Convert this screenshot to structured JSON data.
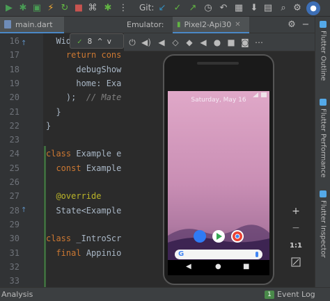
{
  "toolbar": {
    "git_label": "Git:",
    "icons": [
      "run-icon",
      "debug-icon",
      "coverage-icon",
      "lightning-icon",
      "stop-icon",
      "devtools-icon",
      "attach-icon",
      "git-update-icon",
      "git-commit-icon",
      "git-push-icon",
      "history-icon",
      "revert-icon",
      "search-icon",
      "settings-icon",
      "avatar-icon"
    ]
  },
  "editor": {
    "tab_label": "main.dart",
    "hint": {
      "check_count": "8",
      "arrows": "^ v"
    },
    "line_numbers": [
      "16",
      "17",
      "18",
      "19",
      "20",
      "21",
      "22",
      "23",
      "24",
      "25",
      "26",
      "27",
      "28",
      "29",
      "30",
      "31",
      "32",
      "33"
    ],
    "code_lines": [
      {
        "indent": "  ",
        "parts": [
          {
            "t": "Wid",
            "c": ""
          }
        ]
      },
      {
        "indent": "    ",
        "parts": [
          {
            "t": "return ",
            "c": "kw"
          },
          {
            "t": "cons",
            "c": "kw"
          }
        ]
      },
      {
        "indent": "      ",
        "parts": [
          {
            "t": "debugShow",
            "c": ""
          }
        ]
      },
      {
        "indent": "      ",
        "parts": [
          {
            "t": "home: Exa",
            "c": ""
          }
        ]
      },
      {
        "indent": "    ",
        "parts": [
          {
            "t": ");  ",
            "c": ""
          },
          {
            "t": "// Mate",
            "c": "cm"
          }
        ]
      },
      {
        "indent": "  ",
        "parts": [
          {
            "t": "}",
            "c": ""
          }
        ]
      },
      {
        "indent": "",
        "parts": [
          {
            "t": "}",
            "c": ""
          }
        ]
      },
      {
        "indent": "",
        "parts": [
          {
            "t": "",
            "c": ""
          }
        ]
      },
      {
        "indent": "",
        "parts": [
          {
            "t": "class ",
            "c": "kw"
          },
          {
            "t": "Example e",
            "c": ""
          }
        ]
      },
      {
        "indent": "  ",
        "parts": [
          {
            "t": "const ",
            "c": "kw"
          },
          {
            "t": "Example",
            "c": ""
          }
        ]
      },
      {
        "indent": "",
        "parts": [
          {
            "t": "",
            "c": ""
          }
        ]
      },
      {
        "indent": "  ",
        "parts": [
          {
            "t": "@override",
            "c": "ann"
          }
        ]
      },
      {
        "indent": "  ",
        "parts": [
          {
            "t": "State<Example",
            "c": ""
          }
        ]
      },
      {
        "indent": "",
        "parts": [
          {
            "t": "",
            "c": ""
          }
        ]
      },
      {
        "indent": "",
        "parts": [
          {
            "t": "class ",
            "c": "kw"
          },
          {
            "t": "_IntroScr",
            "c": ""
          }
        ]
      },
      {
        "indent": "  ",
        "parts": [
          {
            "t": "final ",
            "c": "kw"
          },
          {
            "t": "Appinio",
            "c": ""
          }
        ]
      },
      {
        "indent": "",
        "parts": [
          {
            "t": "",
            "c": ""
          }
        ]
      },
      {
        "indent": "",
        "parts": [
          {
            "t": "",
            "c": ""
          }
        ]
      }
    ]
  },
  "emulator": {
    "panel_title": "Emulator:",
    "device_tab": "Pixel2-Api30",
    "controls": [
      "power-icon",
      "volume-up-icon",
      "volume-down-icon",
      "rotate-left-icon",
      "rotate-right-icon",
      "back-icon",
      "home-icon",
      "overview-icon",
      "camera-icon",
      "ellipsis-icon"
    ],
    "screen": {
      "date": "Saturday, May 16",
      "nav": [
        "◀",
        "●",
        "■"
      ]
    },
    "zoom": {
      "plus": "+",
      "minus": "−",
      "one_to_one": "1:1"
    }
  },
  "right_strip": {
    "tabs": [
      "Flutter Outline",
      "Flutter Performance",
      "Flutter Inspector"
    ]
  },
  "bottom_bar": {
    "left": "Analysis",
    "right_badge": "1",
    "right_label": "Event Log"
  },
  "colors": {
    "accent": "#4a88c7",
    "run_green": "#499c54",
    "git_blue": "#3592c4",
    "git_green": "#62b543"
  }
}
